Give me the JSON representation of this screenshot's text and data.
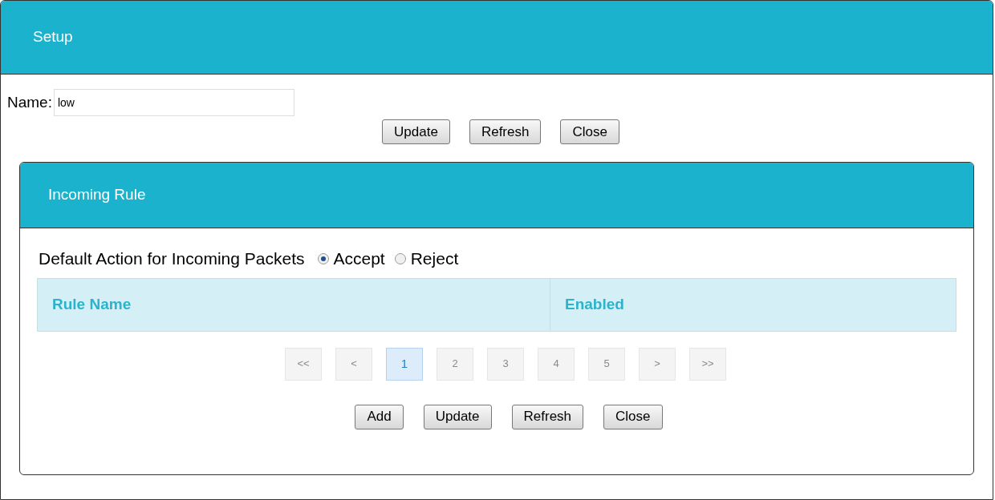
{
  "panel": {
    "title": "Setup"
  },
  "name_field": {
    "label": "Name:",
    "value": "low"
  },
  "top_buttons": [
    "Update",
    "Refresh",
    "Close"
  ],
  "incoming_rule": {
    "title": "Incoming Rule",
    "default_action": {
      "label": "Default Action for Incoming Packets",
      "options": [
        {
          "label": "Accept",
          "selected": true
        },
        {
          "label": "Reject",
          "selected": false
        }
      ]
    },
    "table": {
      "columns": [
        "Rule Name",
        "Enabled"
      ]
    },
    "pagination": [
      {
        "label": "<<",
        "selected": false
      },
      {
        "label": "<",
        "selected": false
      },
      {
        "label": "1",
        "selected": true
      },
      {
        "label": "2",
        "selected": false
      },
      {
        "label": "3",
        "selected": false
      },
      {
        "label": "4",
        "selected": false
      },
      {
        "label": "5",
        "selected": false
      },
      {
        "label": ">",
        "selected": false
      },
      {
        "label": ">>",
        "selected": false
      }
    ],
    "buttons": [
      "Add",
      "Update",
      "Refresh",
      "Close"
    ]
  }
}
